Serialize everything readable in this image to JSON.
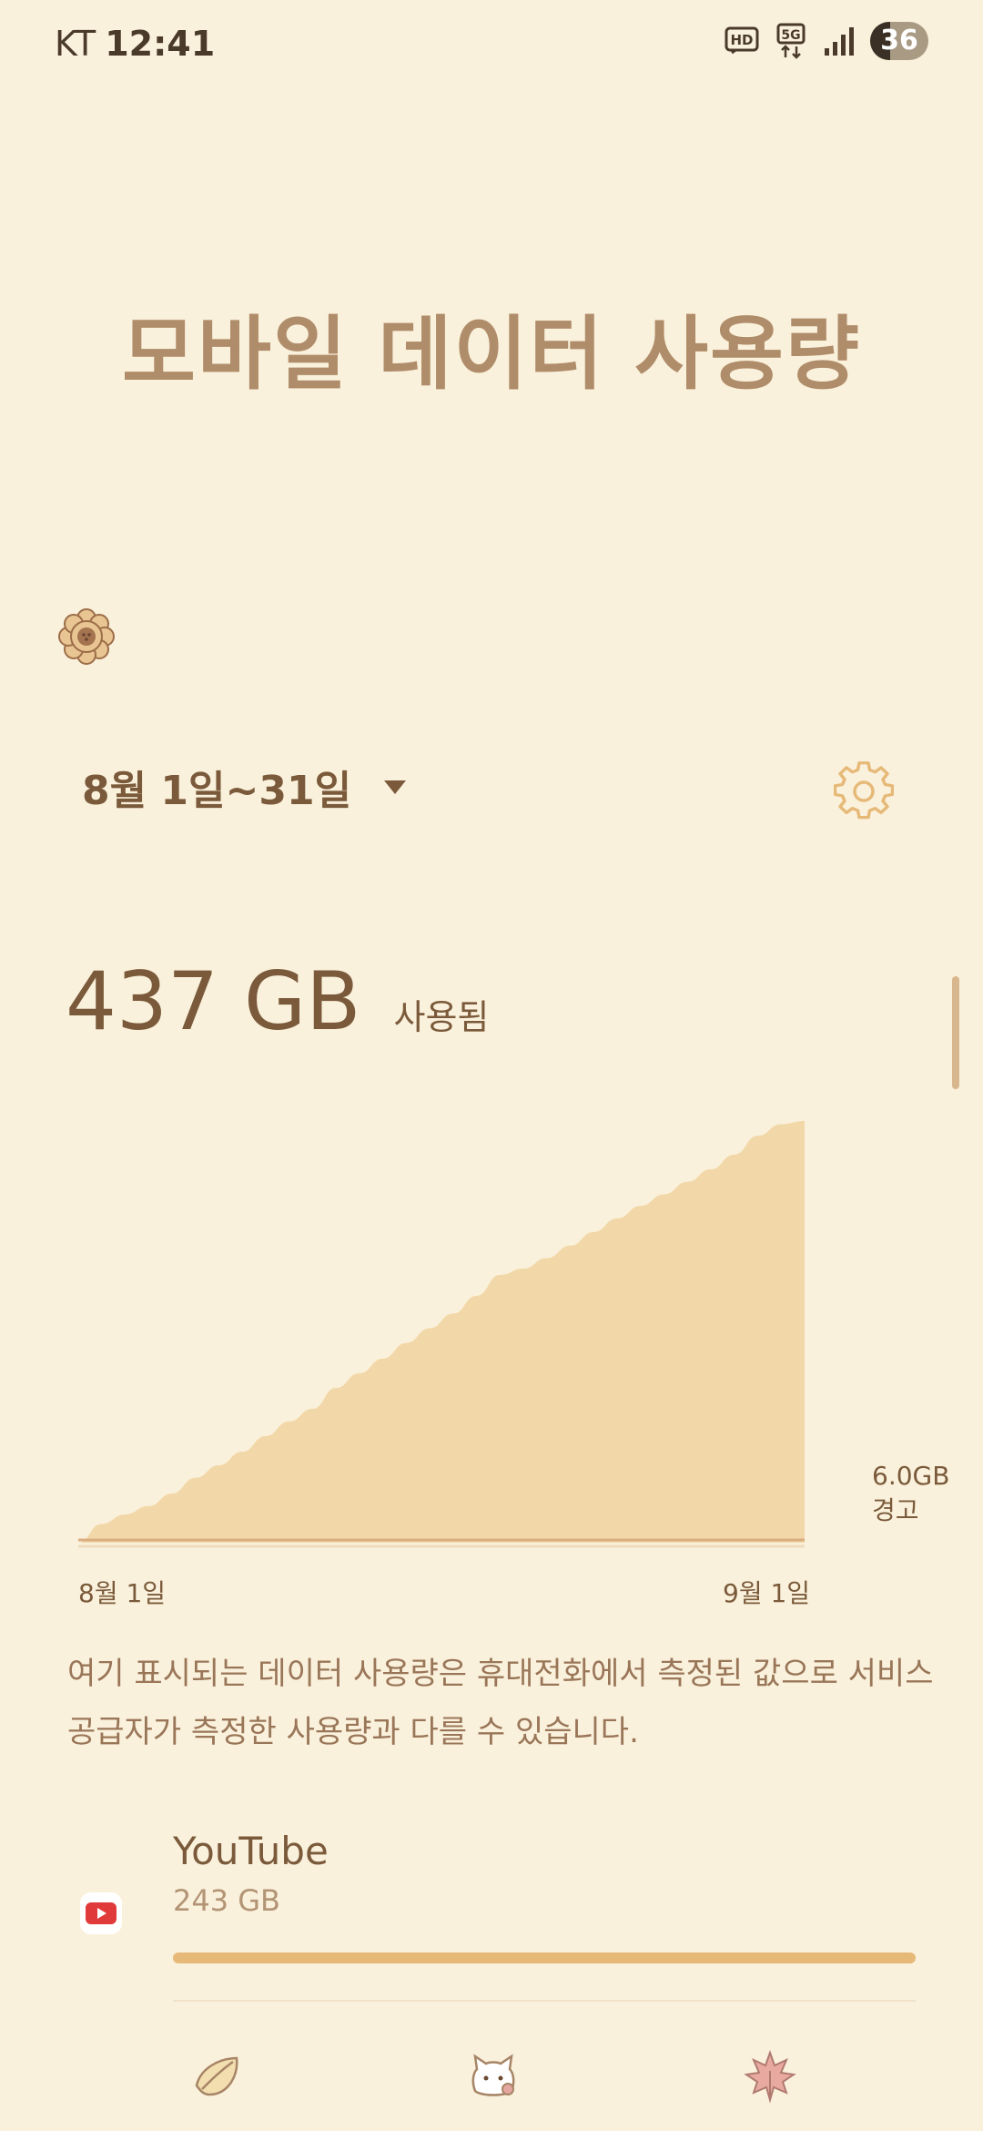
{
  "status_bar": {
    "carrier": "KT",
    "time": "12:41",
    "battery": "36",
    "icons": [
      "hd-voice-icon",
      "5g-icon",
      "signal-icon",
      "battery-icon"
    ]
  },
  "page": {
    "title": "모바일 데이터 사용량"
  },
  "period": {
    "label": "8월 1일~31일"
  },
  "summary": {
    "value": "437 GB",
    "unit": "사용됨"
  },
  "chart_data": {
    "type": "area",
    "x_labels": [
      "8월 1일",
      "9월 1일"
    ],
    "warning_label": "6.0GB\n경고",
    "values_gb": [
      0,
      18,
      27,
      35,
      47,
      62,
      74,
      87,
      102,
      116,
      128,
      148,
      162,
      176,
      191,
      205,
      219,
      236,
      256,
      262,
      272,
      284,
      297,
      310,
      322,
      333,
      345,
      357,
      371,
      389,
      400,
      403
    ],
    "ylim_gb": [
      0,
      437
    ],
    "colors": {
      "fill": "#f2d8a9",
      "line": "#d9ae80"
    }
  },
  "disclaimer": "여기 표시되는 데이터 사용량은 휴대전화에서 측정된 값으로 서비스 공급자가 측정한 사용량과 다를 수 있습니다.",
  "apps": [
    {
      "name": "YouTube",
      "usage": "243 GB",
      "fraction": 1.0,
      "icon": "youtube-icon"
    }
  ],
  "bottom_nav": [
    "leaf-icon",
    "cat-icon",
    "maple-leaf-icon"
  ],
  "colors": {
    "background": "#faf1dc",
    "text": "#7a5a3a",
    "title": "#b08d6a",
    "accent": "#e6b978"
  }
}
